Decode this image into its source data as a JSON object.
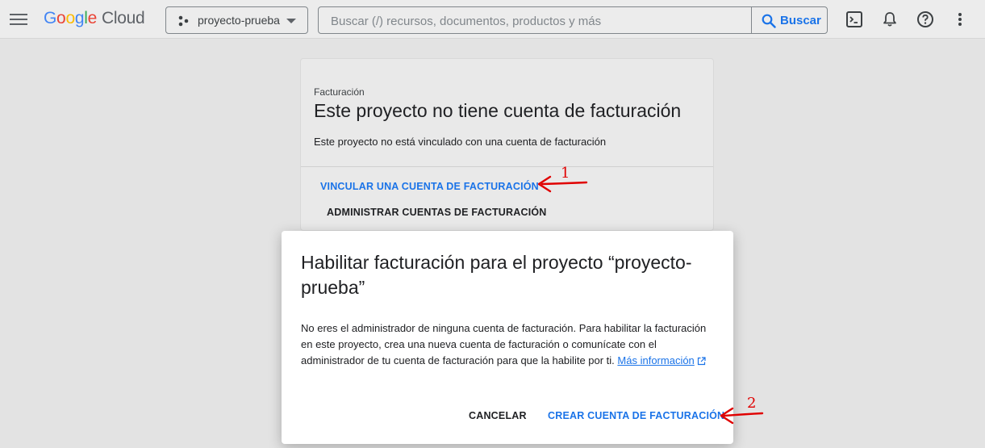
{
  "header": {
    "logo_google": [
      "G",
      "o",
      "o",
      "g",
      "l",
      "e"
    ],
    "logo_cloud": "Cloud",
    "project_name": "proyecto-prueba",
    "search_placeholder": "Buscar (/) recursos, documentos, productos y más",
    "search_button": "Buscar",
    "icons": [
      "menu-icon",
      "terminal-icon",
      "bell-icon",
      "help-icon",
      "more-vert-icon"
    ]
  },
  "billing_card": {
    "overline": "Facturación",
    "title": "Este proyecto no tiene cuenta de facturación",
    "description": "Este proyecto no está vinculado con una cuenta de facturación",
    "link_button": "VINCULAR UNA CUENTA DE FACTURACIÓN",
    "manage_button": "ADMINISTRAR CUENTAS DE FACTURACIÓN"
  },
  "dialog": {
    "title": "Habilitar facturación para el proyecto “proyecto-prueba”",
    "body": "No eres el administrador de ninguna cuenta de facturación. Para habilitar la facturación en este proyecto, crea una nueva cuenta de facturación o comunícate con el administrador de tu cuenta de facturación para que la habilite por ti.",
    "more_info": "Más información",
    "cancel_button": "CANCELAR",
    "create_button": "CREAR CUENTA DE FACTURACIÓN"
  },
  "annotations": {
    "mark_1": "1",
    "mark_2": "2",
    "color": "#e00000"
  },
  "colors": {
    "accent": "#1a73e8",
    "overlay_bg": "#e3e3e3"
  }
}
